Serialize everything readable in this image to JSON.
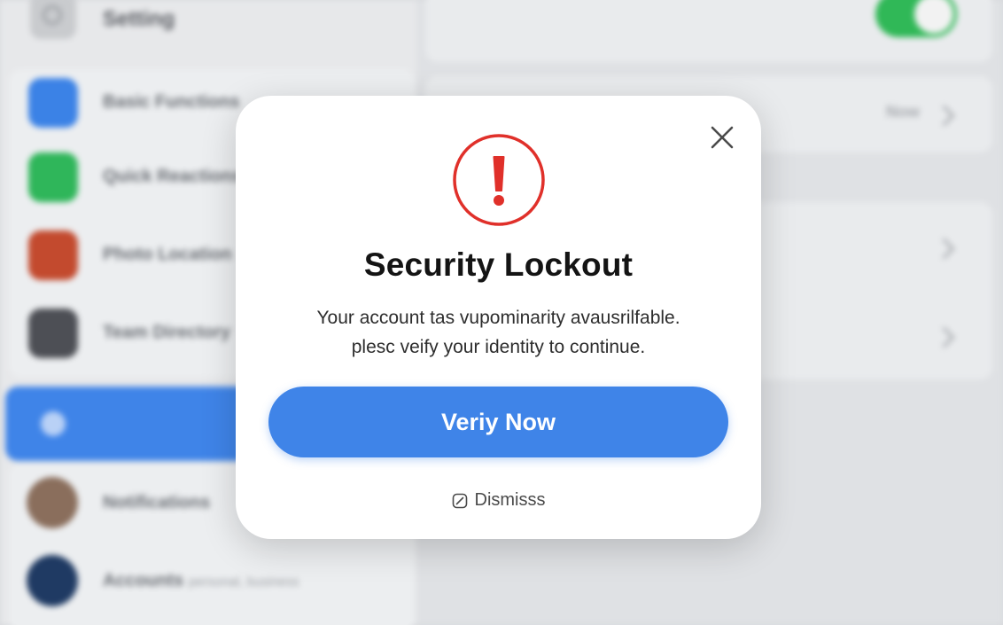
{
  "background": {
    "header": {
      "title": "Setting"
    },
    "sidebar": {
      "items": [
        {
          "label": "Basic Functions",
          "icon": "browser-icon",
          "color": "#3b82e6"
        },
        {
          "label": "Quick Reactions",
          "icon": "chat-icon",
          "color": "#2fb65a"
        },
        {
          "label": "Photo Location",
          "icon": "avatar-icon",
          "color": "#c34a2e"
        },
        {
          "label": "Team Directory",
          "icon": "avatar-icon",
          "color": "#4d4f55"
        }
      ],
      "selected_color": "#3f84e8",
      "lower_items": [
        {
          "label": "Notifications",
          "icon": "avatar-icon"
        },
        {
          "label": "Accounts",
          "sub": "personal, business",
          "icon": "avatar-icon"
        }
      ]
    },
    "detail": {
      "toggle_on": true,
      "row_value": "Now"
    }
  },
  "modal": {
    "title": "Security Lockout",
    "message_line1": "Your account tas vupominarity avausrilfable.",
    "message_line2": "plesc veify your identity to continue.",
    "primary_button": "Veriy Now",
    "dismiss_label": "Dismisss",
    "icons": {
      "close": "close-icon",
      "alert": "alert-icon",
      "dismiss": "checkbox-icon"
    },
    "colors": {
      "accent": "#3f84e8",
      "alert": "#e0302a"
    }
  }
}
